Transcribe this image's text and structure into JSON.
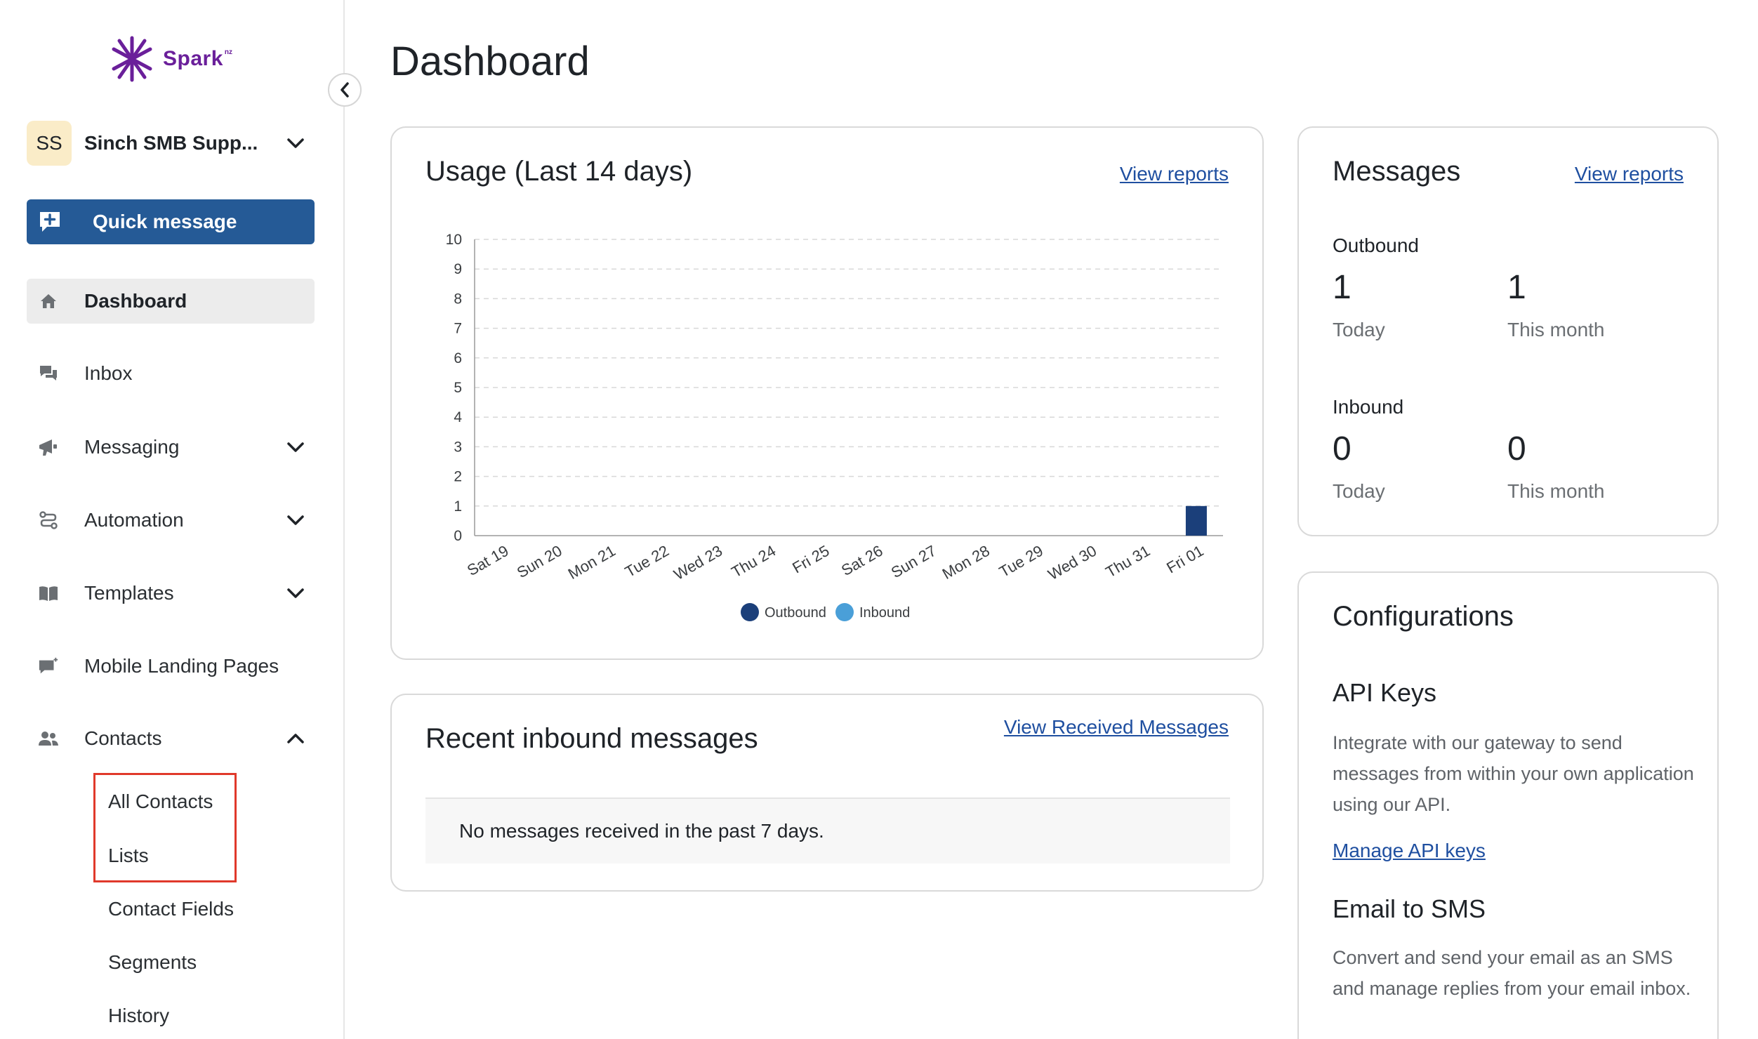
{
  "brand": {
    "name": "Spark",
    "suffix": "nz"
  },
  "account": {
    "initials": "SS",
    "name": "Sinch SMB Supp..."
  },
  "quick_message": {
    "label": "Quick message"
  },
  "nav": {
    "dashboard": "Dashboard",
    "inbox": "Inbox",
    "messaging": "Messaging",
    "automation": "Automation",
    "templates": "Templates",
    "mobile_landing_pages": "Mobile Landing Pages",
    "contacts": "Contacts"
  },
  "contacts_sub": {
    "all_contacts": "All Contacts",
    "lists": "Lists",
    "contact_fields": "Contact Fields",
    "segments": "Segments",
    "history": "History"
  },
  "page": {
    "title": "Dashboard"
  },
  "usage": {
    "title": "Usage (Last 14 days)",
    "link": "View reports"
  },
  "chart_data": {
    "type": "bar",
    "categories": [
      "Sat 19",
      "Sun 20",
      "Mon 21",
      "Tue 22",
      "Wed 23",
      "Thu 24",
      "Fri 25",
      "Sat 26",
      "Sun 27",
      "Mon 28",
      "Tue 29",
      "Wed 30",
      "Thu 31",
      "Fri 01"
    ],
    "series": [
      {
        "name": "Outbound",
        "color": "#1b3f7a",
        "values": [
          0,
          0,
          0,
          0,
          0,
          0,
          0,
          0,
          0,
          0,
          0,
          0,
          0,
          1
        ]
      },
      {
        "name": "Inbound",
        "color": "#4a9fd8",
        "values": [
          0,
          0,
          0,
          0,
          0,
          0,
          0,
          0,
          0,
          0,
          0,
          0,
          0,
          0
        ]
      }
    ],
    "yticks": [
      "0",
      "1",
      "2",
      "3",
      "4",
      "5",
      "6",
      "7",
      "8",
      "9",
      "10"
    ],
    "ylim": [
      0,
      10
    ],
    "grid": true,
    "legend": "bottom-center"
  },
  "recent": {
    "title": "Recent inbound messages",
    "link": "View Received Messages",
    "empty": "No messages received in the past 7 days."
  },
  "messages": {
    "title": "Messages",
    "link": "View reports",
    "outbound": {
      "label": "Outbound",
      "today": "1",
      "today_label": "Today",
      "month": "1",
      "month_label": "This month"
    },
    "inbound": {
      "label": "Inbound",
      "today": "0",
      "today_label": "Today",
      "month": "0",
      "month_label": "This month"
    }
  },
  "config": {
    "title": "Configurations",
    "api": {
      "title": "API Keys",
      "desc": "Integrate with our gateway to send messages from within your own application using our API.",
      "link": "Manage API keys"
    },
    "email": {
      "title": "Email to SMS",
      "desc": "Convert and send your email as an SMS and manage replies from your email inbox."
    }
  },
  "colors": {
    "primary": "#255a96",
    "highlight": "#e0392b",
    "brand": "#6a1f9a"
  }
}
